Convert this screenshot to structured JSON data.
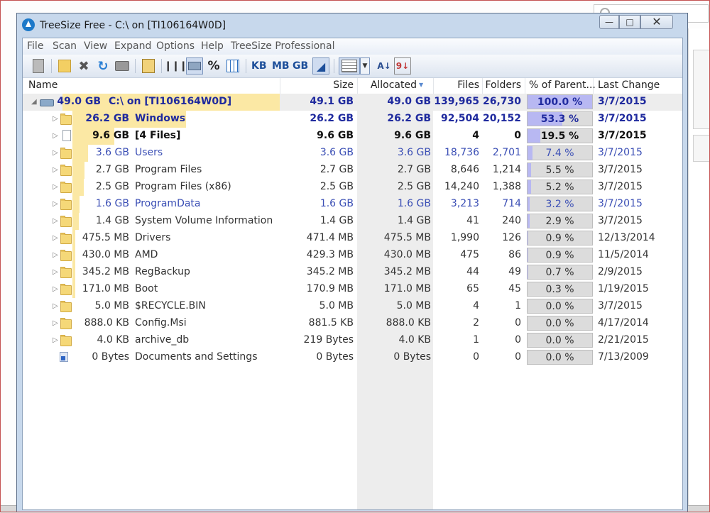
{
  "window": {
    "title": "TreeSize Free - C:\\  on  [TI106164W0D]"
  },
  "menu": [
    "File",
    "Scan",
    "View",
    "Expand",
    "Options",
    "Help",
    "TreeSize Professional"
  ],
  "toolbar": {
    "kb": "KB",
    "mb": "MB",
    "gb": "GB",
    "percent": "%"
  },
  "columns": {
    "name": "Name",
    "size": "Size",
    "allocated": "Allocated",
    "files": "Files",
    "folders": "Folders",
    "percent": "% of Parent...",
    "last_change": "Last Change"
  },
  "colors": {
    "text_blue": "#1f2a9e",
    "link_blue": "#3b4fb5",
    "normal": "#333333",
    "bar_yellow": "#fbe8a4",
    "pct_fill": "#b8b8f2"
  },
  "rows": [
    {
      "type": "root",
      "label_size": "49.0 GB",
      "name": "C:\\  on  [TI106164W0D]",
      "size": "49.1 GB",
      "allocated": "49.0 GB",
      "files": "139,965",
      "folders": "26,730",
      "percent": "100.0 %",
      "pct": 100,
      "last_change": "3/7/2015",
      "bold": true,
      "color": "blue",
      "bar": 1.0
    },
    {
      "type": "folder",
      "label_size": "26.2 GB",
      "name": "Windows",
      "size": "26.2 GB",
      "allocated": "26.2 GB",
      "files": "92,504",
      "folders": "20,152",
      "percent": "53.3 %",
      "pct": 53.3,
      "last_change": "3/7/2015",
      "bold": true,
      "color": "blue",
      "bar": 0.533
    },
    {
      "type": "file",
      "label_size": "9.6 GB",
      "name": "[4 Files]",
      "size": "9.6 GB",
      "allocated": "9.6 GB",
      "files": "4",
      "folders": "0",
      "percent": "19.5 %",
      "pct": 19.5,
      "last_change": "3/7/2015",
      "bold": true,
      "color": "black",
      "bar": 0.195
    },
    {
      "type": "folder",
      "label_size": "3.6 GB",
      "name": "Users",
      "size": "3.6 GB",
      "allocated": "3.6 GB",
      "files": "18,736",
      "folders": "2,701",
      "percent": "7.4 %",
      "pct": 7.4,
      "last_change": "3/7/2015",
      "bold": false,
      "color": "link",
      "bar": 0.074
    },
    {
      "type": "folder",
      "label_size": "2.7 GB",
      "name": "Program Files",
      "size": "2.7 GB",
      "allocated": "2.7 GB",
      "files": "8,646",
      "folders": "1,214",
      "percent": "5.5 %",
      "pct": 5.5,
      "last_change": "3/7/2015",
      "bold": false,
      "color": "normal",
      "bar": 0.055
    },
    {
      "type": "folder",
      "label_size": "2.5 GB",
      "name": "Program Files (x86)",
      "size": "2.5 GB",
      "allocated": "2.5 GB",
      "files": "14,240",
      "folders": "1,388",
      "percent": "5.2 %",
      "pct": 5.2,
      "last_change": "3/7/2015",
      "bold": false,
      "color": "normal",
      "bar": 0.052
    },
    {
      "type": "folder",
      "label_size": "1.6 GB",
      "name": "ProgramData",
      "size": "1.6 GB",
      "allocated": "1.6 GB",
      "files": "3,213",
      "folders": "714",
      "percent": "3.2 %",
      "pct": 3.2,
      "last_change": "3/7/2015",
      "bold": false,
      "color": "link",
      "bar": 0.032
    },
    {
      "type": "folder",
      "label_size": "1.4 GB",
      "name": "System Volume Information",
      "size": "1.4 GB",
      "allocated": "1.4 GB",
      "files": "41",
      "folders": "240",
      "percent": "2.9 %",
      "pct": 2.9,
      "last_change": "3/7/2015",
      "bold": false,
      "color": "normal",
      "bar": 0.029
    },
    {
      "type": "folder",
      "label_size": "475.5 MB",
      "name": "Drivers",
      "size": "471.4 MB",
      "allocated": "475.5 MB",
      "files": "1,990",
      "folders": "126",
      "percent": "0.9 %",
      "pct": 0.9,
      "last_change": "12/13/2014",
      "bold": false,
      "color": "normal",
      "bar": 0.009
    },
    {
      "type": "folder",
      "label_size": "430.0 MB",
      "name": "AMD",
      "size": "429.3 MB",
      "allocated": "430.0 MB",
      "files": "475",
      "folders": "86",
      "percent": "0.9 %",
      "pct": 0.9,
      "last_change": "11/5/2014",
      "bold": false,
      "color": "normal",
      "bar": 0.009
    },
    {
      "type": "folder",
      "label_size": "345.2 MB",
      "name": "RegBackup",
      "size": "345.2 MB",
      "allocated": "345.2 MB",
      "files": "44",
      "folders": "49",
      "percent": "0.7 %",
      "pct": 0.7,
      "last_change": "2/9/2015",
      "bold": false,
      "color": "normal",
      "bar": 0.007
    },
    {
      "type": "folder",
      "label_size": "171.0 MB",
      "name": "Boot",
      "size": "170.9 MB",
      "allocated": "171.0 MB",
      "files": "65",
      "folders": "45",
      "percent": "0.3 %",
      "pct": 0.3,
      "last_change": "1/19/2015",
      "bold": false,
      "color": "normal",
      "bar": 0.003
    },
    {
      "type": "folder",
      "label_size": "5.0 MB",
      "name": "$RECYCLE.BIN",
      "size": "5.0 MB",
      "allocated": "5.0 MB",
      "files": "4",
      "folders": "1",
      "percent": "0.0 %",
      "pct": 0,
      "last_change": "3/7/2015",
      "bold": false,
      "color": "normal",
      "bar": 0
    },
    {
      "type": "folder",
      "label_size": "888.0 KB",
      "name": "Config.Msi",
      "size": "881.5 KB",
      "allocated": "888.0 KB",
      "files": "2",
      "folders": "0",
      "percent": "0.0 %",
      "pct": 0,
      "last_change": "4/17/2014",
      "bold": false,
      "color": "normal",
      "bar": 0
    },
    {
      "type": "folder",
      "label_size": "4.0 KB",
      "name": "archive_db",
      "size": "219 Bytes",
      "allocated": "4.0 KB",
      "files": "1",
      "folders": "0",
      "percent": "0.0 %",
      "pct": 0,
      "last_change": "2/21/2015",
      "bold": false,
      "color": "normal",
      "bar": 0
    },
    {
      "type": "link",
      "label_size": "0 Bytes",
      "name": "Documents and Settings",
      "size": "0 Bytes",
      "allocated": "0 Bytes",
      "files": "0",
      "folders": "0",
      "percent": "0.0 %",
      "pct": 0,
      "last_change": "7/13/2009",
      "bold": false,
      "color": "normal",
      "bar": 0
    }
  ]
}
